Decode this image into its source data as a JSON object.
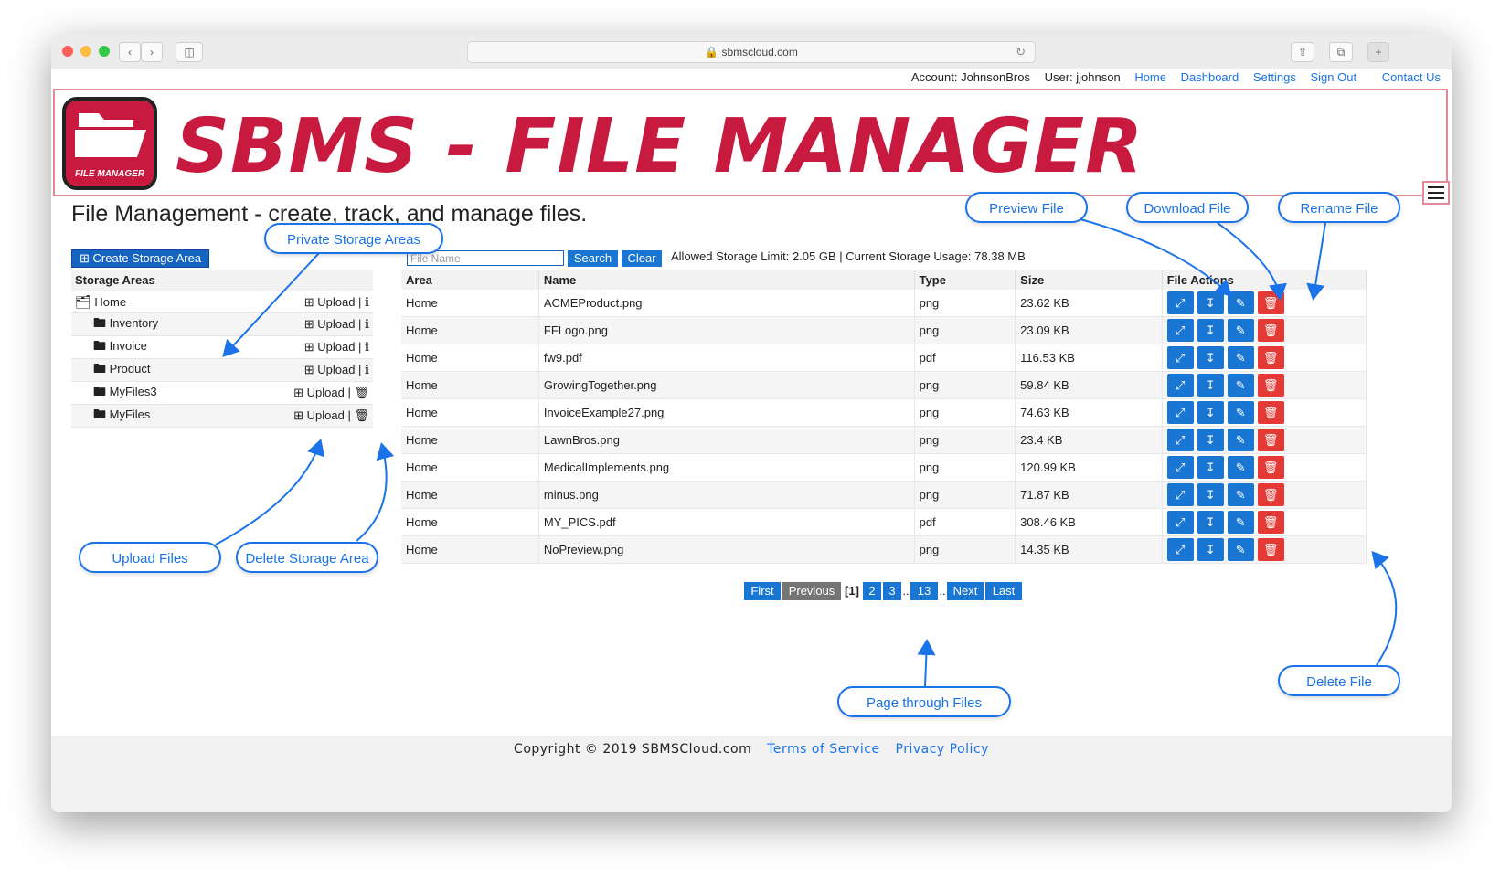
{
  "browser": {
    "url": "sbmscloud.com"
  },
  "topnav": {
    "account": "Account: JohnsonBros",
    "user": "User: jjohnson",
    "home": "Home",
    "dashboard": "Dashboard",
    "settings": "Settings",
    "signout": "Sign Out",
    "contact": "Contact Us"
  },
  "banner": {
    "title": "SBMS - FILE MANAGER",
    "logo_text": "FILE MANAGER"
  },
  "page": {
    "heading": "File Management - create, track, and manage files."
  },
  "sidebar": {
    "create_label": "Create Storage Area",
    "header": "Storage Areas",
    "upload_label": "Upload",
    "items": [
      {
        "name": "Home",
        "icon": "folder-open-icon",
        "action": "info"
      },
      {
        "name": "Inventory",
        "icon": "folder-icon",
        "action": "info"
      },
      {
        "name": "Invoice",
        "icon": "folder-icon",
        "action": "info"
      },
      {
        "name": "Product",
        "icon": "folder-icon",
        "action": "info"
      },
      {
        "name": "MyFiles3",
        "icon": "folder-icon",
        "action": "delete"
      },
      {
        "name": "MyFiles",
        "icon": "folder-icon",
        "action": "delete"
      }
    ]
  },
  "search": {
    "placeholder": "File Name",
    "search_label": "Search",
    "clear_label": "Clear",
    "storage_info": "Allowed Storage Limit: 2.05 GB | Current Storage Usage: 78.38 MB"
  },
  "table": {
    "headers": [
      "Area",
      "Name",
      "Type",
      "Size",
      "File Actions"
    ],
    "rows": [
      [
        "Home",
        "ACMEProduct.png",
        "png",
        "23.62 KB"
      ],
      [
        "Home",
        "FFLogo.png",
        "png",
        "23.09 KB"
      ],
      [
        "Home",
        "fw9.pdf",
        "pdf",
        "116.53 KB"
      ],
      [
        "Home",
        "GrowingTogether.png",
        "png",
        "59.84 KB"
      ],
      [
        "Home",
        "InvoiceExample27.png",
        "png",
        "74.63 KB"
      ],
      [
        "Home",
        "LawnBros.png",
        "png",
        "23.4 KB"
      ],
      [
        "Home",
        "MedicalImplements.png",
        "png",
        "120.99 KB"
      ],
      [
        "Home",
        "minus.png",
        "png",
        "71.87 KB"
      ],
      [
        "Home",
        "MY_PICS.pdf",
        "pdf",
        "308.46 KB"
      ],
      [
        "Home",
        "NoPreview.png",
        "png",
        "14.35 KB"
      ]
    ]
  },
  "pager": {
    "first": "First",
    "previous": "Previous",
    "current": "[1]",
    "p2": "2",
    "p3": "3",
    "ellipsis": "..",
    "p13": "13",
    "next": "Next",
    "last": "Last"
  },
  "footer": {
    "copyright": "Copyright © 2019 SBMSCloud.com",
    "terms": "Terms of Service",
    "privacy": "Privacy Policy"
  },
  "callouts": {
    "private": "Private Storage Areas",
    "preview": "Preview File",
    "download": "Download File",
    "rename": "Rename File",
    "upload": "Upload Files",
    "delete_area": "Delete Storage Area",
    "page": "Page through Files",
    "delete_file": "Delete File"
  },
  "colors": {
    "brand": "#c8193f",
    "accent": "#1976d2",
    "danger": "#e53935",
    "callout": "#1a73e8"
  }
}
